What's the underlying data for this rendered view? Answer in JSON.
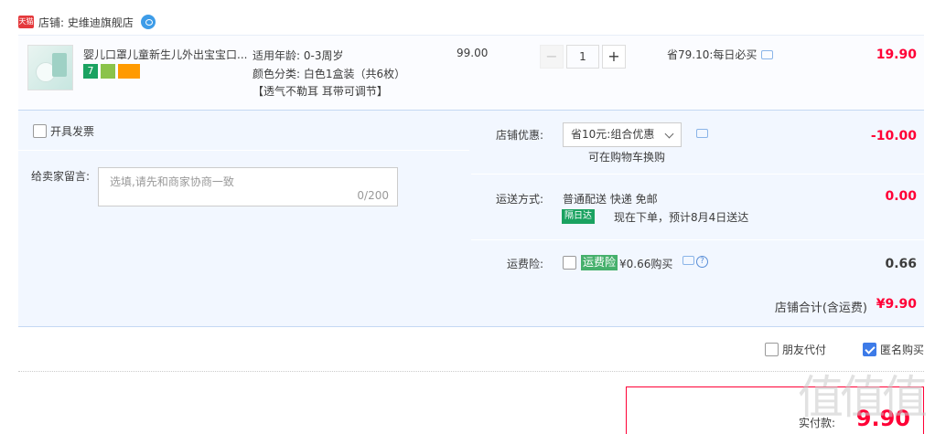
{
  "store": {
    "logo_text": "天猫",
    "name": "店铺: 史维迪旗舰店"
  },
  "item": {
    "title": "婴儿口罩儿童新生儿外出宝宝口...",
    "badges": [
      "7",
      "shield-badge",
      "card-badge"
    ],
    "specs": [
      "适用年龄: 0-3周岁",
      "颜色分类: 白色1盒装（共6枚）"
    ],
    "tags": "【透气不勒耳 耳带可调节】",
    "unit_price": "99.00",
    "quantity": "1",
    "minus": "−",
    "plus": "+",
    "saving": "省79.10:每日必买",
    "total": "19.90"
  },
  "options": {
    "invoice_label": "开具发票",
    "message_label": "给卖家留言:",
    "message_placeholder": "选填,请先和商家协商一致",
    "message_count": "0/200",
    "coupon_label": "店铺优惠:",
    "coupon_selected": "省10元:组合优惠",
    "coupon_note": "可在购物车换购",
    "coupon_amount": "-10.00",
    "shipping_label": "运送方式:",
    "shipping_method": "普通配送 快递 免邮",
    "shipping_tag": "隔日达",
    "shipping_eta": "现在下单，预计8月4日送达",
    "shipping_amount": "0.00",
    "insurance_label": "运费险:",
    "insurance_tag": "运费险",
    "insurance_text": "¥0.66购买",
    "insurance_amount": "0.66",
    "help_mark": "?"
  },
  "store_total": {
    "label": "店铺合计(含运费)",
    "value": "¥9.90"
  },
  "footer": {
    "friend_pay": "朋友代付",
    "anonymous": "匿名购买",
    "anonymous_checked": true
  },
  "pay": {
    "label": "实付款:",
    "value": "9.90"
  },
  "watermark": "值值值",
  "colors": {
    "price_red": "#ff0036",
    "panel_blue": "#f2f7ff",
    "accent_blue": "#3d7be8",
    "green": "#1aa260"
  }
}
